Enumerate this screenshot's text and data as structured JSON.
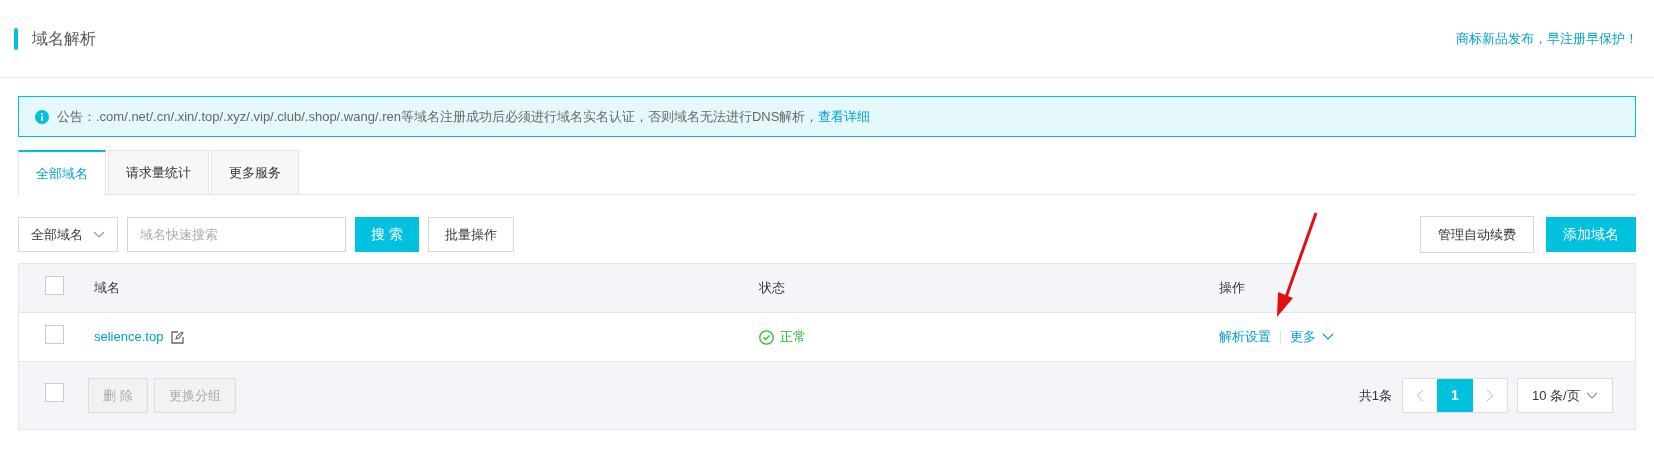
{
  "header": {
    "title": "域名解析",
    "promo_link": "商标新品发布，早注册早保护！"
  },
  "notice": {
    "label": "公告：",
    "text": ".com/.net/.cn/.xin/.top/.xyz/.vip/.club/.shop/.wang/.ren等域名注册成功后必须进行域名实名认证，否则域名无法进行DNS解析，",
    "link": "查看详细"
  },
  "tabs": [
    {
      "label": "全部域名",
      "selected": true
    },
    {
      "label": "请求量统计",
      "selected": false
    },
    {
      "label": "更多服务",
      "selected": false
    }
  ],
  "toolbar": {
    "filter": "全部域名",
    "search_placeholder": "域名快速搜索",
    "search_button": "搜 索",
    "batch_button": "批量操作",
    "renew_button": "管理自动续费",
    "add_button": "添加域名"
  },
  "table": {
    "columns": [
      "域名",
      "状态",
      "操作"
    ],
    "header_checked": false,
    "rows": [
      {
        "checked": false,
        "domain": "selience.top",
        "status": "正常",
        "actions": [
          "解析设置",
          "更多"
        ]
      }
    ]
  },
  "footer": {
    "checked": false,
    "buttons": [
      {
        "label": "删 除",
        "disabled": true
      },
      {
        "label": "更换分组",
        "disabled": true
      }
    ],
    "total": "共1条",
    "pages": [
      {
        "label": "1",
        "selected": true
      }
    ],
    "page_size": "10 条/页"
  }
}
